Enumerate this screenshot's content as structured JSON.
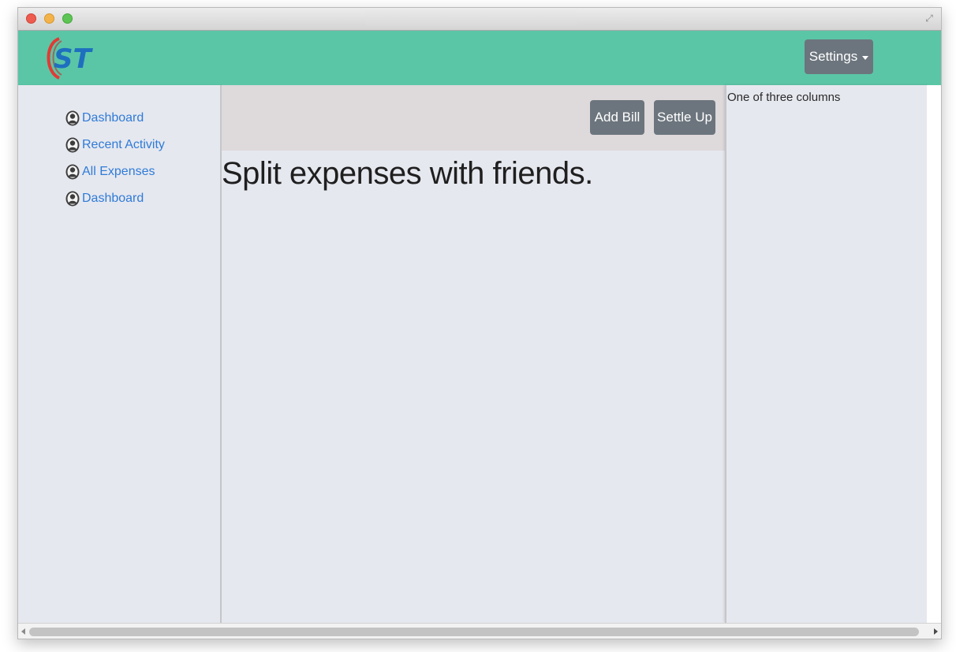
{
  "logo": {
    "text": "ST",
    "colors": {
      "arc": "#e23a35",
      "letters": "#1e6fbf"
    }
  },
  "navbar": {
    "settings_label": "Settings",
    "background": "#5ac6a6"
  },
  "sidebar": {
    "items": [
      {
        "label": "Dashboard",
        "icon": "user-avatar-icon"
      },
      {
        "label": "Recent Activity",
        "icon": "user-avatar-icon"
      },
      {
        "label": "All Expenses",
        "icon": "user-avatar-icon"
      },
      {
        "label": "Dashboard",
        "icon": "user-avatar-icon"
      }
    ]
  },
  "main": {
    "toolbar": {
      "add_bill_label": "Add Bill",
      "settle_up_label": "Settle Up"
    },
    "headline": "Split expenses with friends."
  },
  "right_column": {
    "text": "One of three columns"
  },
  "colors": {
    "button": "#6c757d",
    "link": "#2f7bd8",
    "panel": "#e6e8ef",
    "toolbar": "#ded9db"
  }
}
